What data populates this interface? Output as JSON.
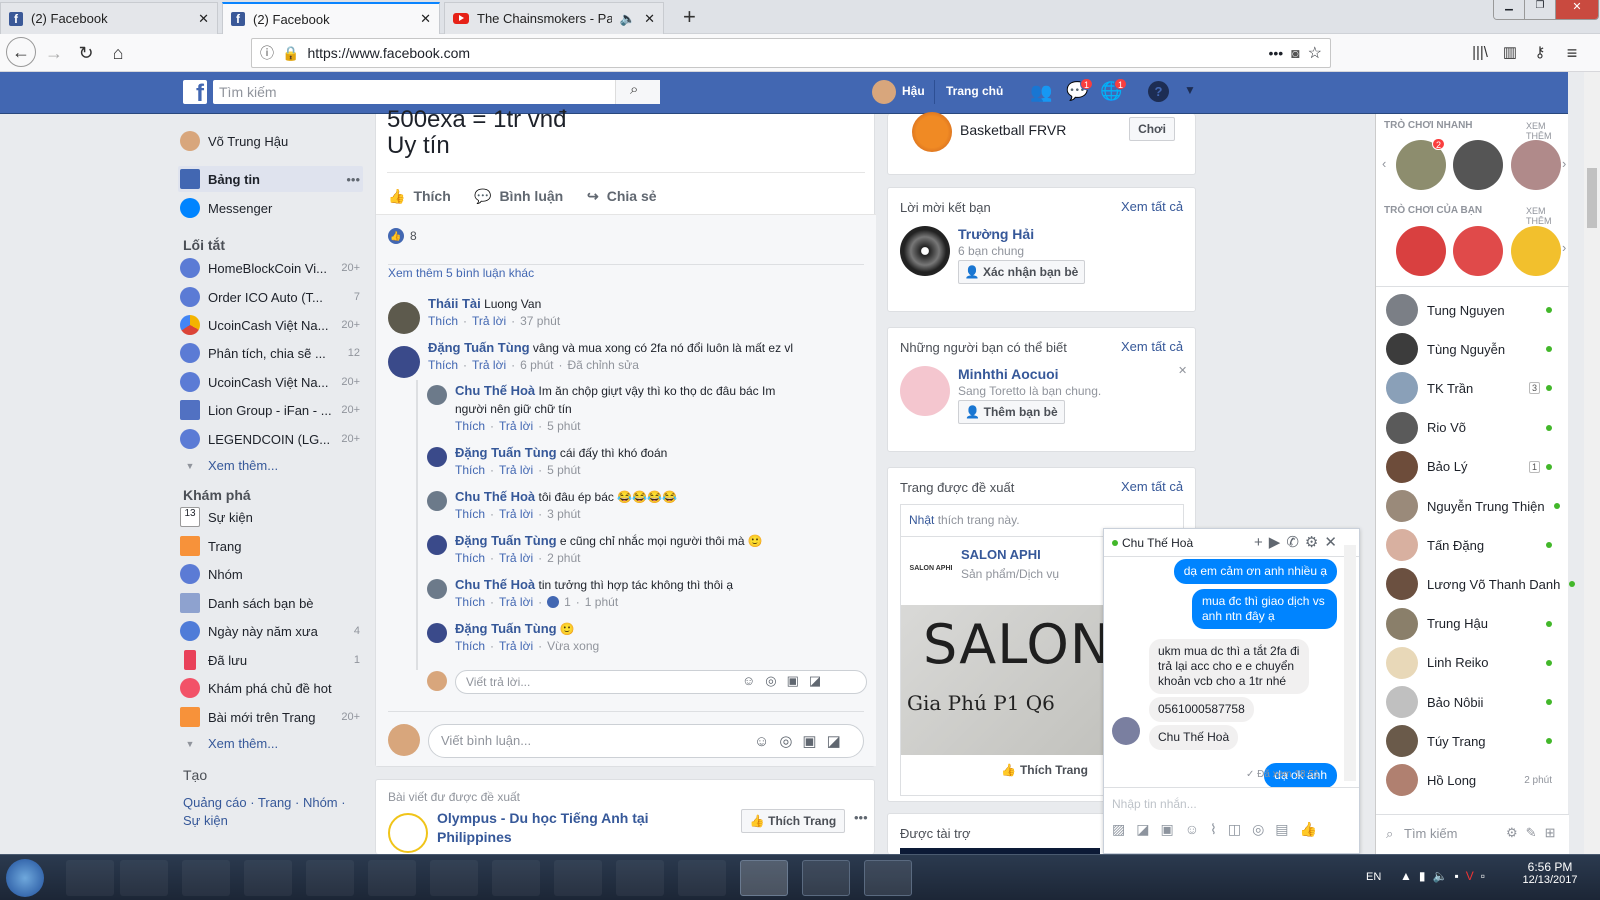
{
  "browser": {
    "tabs": [
      {
        "title": "(2) Facebook",
        "icon": "facebook-icon"
      },
      {
        "title": "(2) Facebook",
        "icon": "facebook-icon"
      },
      {
        "title": "The Chainsmokers - Paris -",
        "icon": "youtube-icon"
      }
    ],
    "url": "https://www.facebook.com"
  },
  "header": {
    "search_placeholder": "Tìm kiếm",
    "user": "Hậu",
    "home": "Trang chủ",
    "messages_badge": "1",
    "notifications_badge": "1"
  },
  "left": {
    "profile": "Võ Trung Hậu",
    "news_feed": "Bảng tin",
    "messenger": "Messenger",
    "shortcuts_title": "Lối tắt",
    "shortcuts": [
      {
        "label": "HomeBlockCoin Vi...",
        "count": "20+"
      },
      {
        "label": "Order ICO Auto (T...",
        "count": "7"
      },
      {
        "label": "UcoinCash Việt Na...",
        "count": "20+"
      },
      {
        "label": "Phân tích, chia sẽ ...",
        "count": "12"
      },
      {
        "label": "UcoinCash Việt Na...",
        "count": "20+"
      },
      {
        "label": "Lion Group - iFan - ...",
        "count": "20+"
      },
      {
        "label": "LEGENDCOIN (LG...",
        "count": "20+"
      }
    ],
    "see_more": "Xem thêm...",
    "explore_title": "Khám phá",
    "explore": [
      {
        "label": "Sự kiện",
        "count": ""
      },
      {
        "label": "Trang",
        "count": ""
      },
      {
        "label": "Nhóm",
        "count": ""
      },
      {
        "label": "Danh sách bạn bè",
        "count": ""
      },
      {
        "label": "Ngày này năm xưa",
        "count": "4"
      },
      {
        "label": "Đã lưu",
        "count": "1"
      },
      {
        "label": "Khám phá chủ đề hot",
        "count": ""
      },
      {
        "label": "Bài mới trên Trang",
        "count": "20+"
      }
    ],
    "see_more2": "Xem thêm...",
    "create_title": "Tạo",
    "create_links": "Quảng cáo · Trang · Nhóm ·",
    "create_events": "Sự kiện"
  },
  "post": {
    "text_line1": "500exa = 1tr vnđ",
    "text_line2": "Uy tín",
    "like": "Thích",
    "comment": "Bình luận",
    "share": "Chia sẻ",
    "reactions": "8",
    "more_comments": "Xem thêm 5 bình luận khác",
    "comments": [
      {
        "name": "Tháii Tài",
        "text": "Luong Van",
        "like": "Thích",
        "reply": "Trả lời",
        "time": "37 phút",
        "extra": ""
      },
      {
        "name": "Đặng Tuấn Tùng",
        "text": "vâng và mua xong có 2fa nó đổi luôn là mất ez vl",
        "like": "Thích",
        "reply": "Trả lời",
        "time": "6 phút",
        "extra": "Đã chỉnh sửa"
      }
    ],
    "replies": [
      {
        "name": "Chu Thế Hoà",
        "text": "Im ăn chộp giựt vậy thì ko thọ dc đâu bác Im",
        "text2": "người nên giữ chữ tín",
        "time": "5 phút",
        "likes": ""
      },
      {
        "name": "Đặng Tuấn Tùng",
        "text": "cái đấy thì khó đoán",
        "text2": "",
        "time": "5 phút",
        "likes": ""
      },
      {
        "name": "Chu Thế Hoà",
        "text": "tôi đâu ép bác 😂😂😂😂",
        "text2": "",
        "time": "3 phút",
        "likes": ""
      },
      {
        "name": "Đặng Tuấn Tùng",
        "text": "e cũng chỉ nhắc mọi người thôi mà 🙂",
        "text2": "",
        "time": "2 phút",
        "likes": ""
      },
      {
        "name": "Chu Thế Hoà",
        "text": "tin tưởng thì hợp tác không thì thôi ạ",
        "text2": "",
        "time": "1 phút",
        "likes": "1"
      },
      {
        "name": "Đặng Tuấn Tùng",
        "text": "🙂",
        "text2": "",
        "time": "Vừa xong",
        "likes": ""
      }
    ],
    "reply_placeholder": "Viết trả lời...",
    "comment_placeholder": "Viết bình luận...",
    "suggested_label": "Bài viết đư được đề xuất",
    "suggested_page": "Olympus - Du học Tiếng Anh tại",
    "suggested_page2": "Philippines",
    "like_page": "Thích Trang"
  },
  "right": {
    "game": "Basketball FRVR",
    "play": "Chơi",
    "friend_requests": "Lời mời kết bạn",
    "see_all": "Xem tất cả",
    "request_name": "Trường Hải",
    "request_mutual": "6 bạn chung",
    "confirm": "Xác nhận bạn bè",
    "pymk": "Những người bạn có thể biết",
    "pymk_name": "Minhthi Aocuoi",
    "pymk_mutual": "Sang Toretto là bạn chung.",
    "add_friend": "Thêm bạn bè",
    "suggested_pages": "Trang được đề xuất",
    "nhat": "Nhật",
    "nhat_rest": "thích trang này.",
    "salon_name": "SALON APHI",
    "salon_cat": "Sản phẩm/Dịch vụ",
    "salon_logo": "SALON APHI",
    "salon_img_title": "SALON",
    "salon_img_sub": "Gia Phú P1 Q6",
    "salon_like": "Thích Trang",
    "sponsored": "Được tài trợ"
  },
  "chatbar": {
    "quick_games": "TRÒ CHƠI NHANH",
    "your_games": "TRÒ CHƠI CỦA BẠN",
    "see_more": "XEM THÊM",
    "game_badge": "2",
    "friends": [
      {
        "name": "Tung Nguyen",
        "status": "dot"
      },
      {
        "name": "Tùng Nguyễn",
        "status": "dot"
      },
      {
        "name": "TK Trần",
        "status": "3"
      },
      {
        "name": "Rio Võ",
        "status": "dot"
      },
      {
        "name": "Bảo Lý",
        "status": "1"
      },
      {
        "name": "Nguyễn Trung Thiện",
        "status": "dot"
      },
      {
        "name": "Tấn Đặng",
        "status": "dot"
      },
      {
        "name": "Lương Võ Thanh Danh",
        "status": "dot"
      },
      {
        "name": "Trung Hậu",
        "status": "dot"
      },
      {
        "name": "Linh Reiko",
        "status": "dot"
      },
      {
        "name": "Bảo Nôbii",
        "status": "dot"
      },
      {
        "name": "Túy Trang",
        "status": "dot"
      },
      {
        "name": "Hồ Long",
        "status": "2 phút"
      }
    ],
    "search_placeholder": "Tìm kiếm"
  },
  "chat": {
    "name": "Chu Thế Hoà",
    "messages": [
      {
        "from": "me",
        "text": "dạ em cảm ơn anh nhiều ạ"
      },
      {
        "from": "me",
        "text": "mua đc thì giao dịch vs anh ntn đây ạ"
      },
      {
        "from": "you",
        "text": "ukm mua dc thì a tắt 2fa đi trả lại acc cho e e chuyển khoản vcb cho a 1tr nhé"
      },
      {
        "from": "you",
        "text": "0561000587758"
      },
      {
        "from": "you",
        "text": "Chu Thế Hoà"
      },
      {
        "from": "me",
        "text": "dạ ok anh"
      }
    ],
    "seen": "✓ Đã xem 18:51",
    "input_placeholder": "Nhập tin nhắn..."
  },
  "taskbar": {
    "lang": "EN",
    "time": "6:56 PM",
    "date": "12/13/2017"
  }
}
